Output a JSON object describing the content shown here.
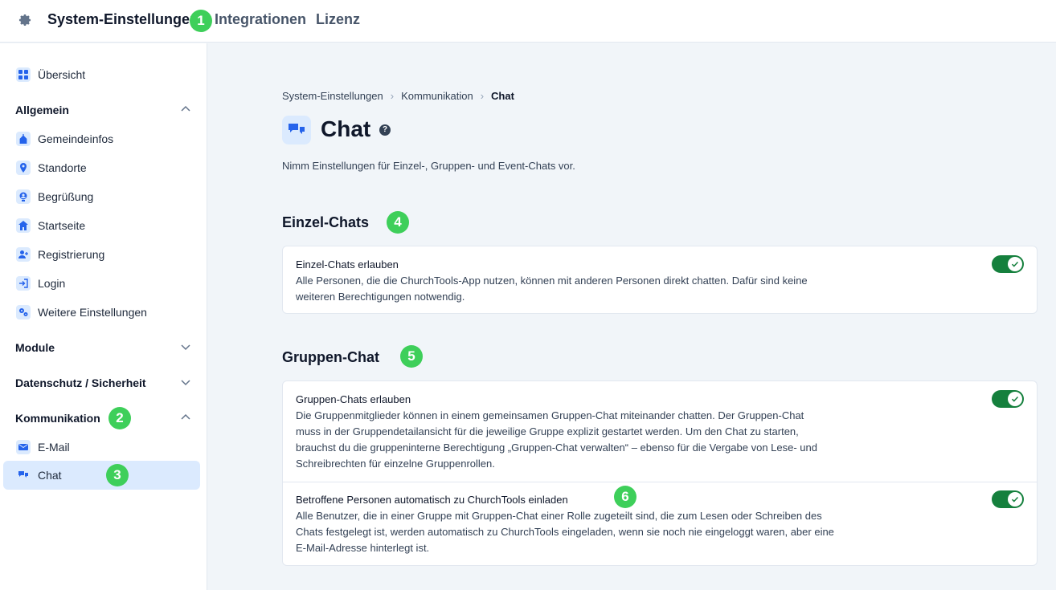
{
  "topbar": {
    "title": "System-Einstellungen",
    "tabs": [
      "Integrationen",
      "Lizenz"
    ]
  },
  "sidebar": {
    "overview": "Übersicht",
    "sections": {
      "allgemein": "Allgemein",
      "module": "Module",
      "datenschutz": "Datenschutz / Sicherheit",
      "kommunikation": "Kommunikation"
    },
    "allgemein_items": [
      "Gemeindeinfos",
      "Standorte",
      "Begrüßung",
      "Startseite",
      "Registrierung",
      "Login",
      "Weitere Einstellungen"
    ],
    "kommunikation_items": [
      "E-Mail",
      "Chat"
    ]
  },
  "breadcrumb": [
    "System-Einstellungen",
    "Kommunikation",
    "Chat"
  ],
  "page": {
    "title": "Chat",
    "help": "?",
    "description": "Nimm Einstellungen für Einzel-, Gruppen- und Event-Chats vor."
  },
  "sections": {
    "einzel": {
      "title": "Einzel-Chats",
      "rows": [
        {
          "title": "Einzel-Chats erlauben",
          "lines": [
            "Alle Personen, die die ChurchTools-App nutzen, können mit anderen Personen direkt chatten. Dafür sind keine",
            "weiteren Berechtigungen notwendig."
          ],
          "enabled": true
        }
      ]
    },
    "gruppen": {
      "title": "Gruppen-Chat",
      "rows": [
        {
          "title": "Gruppen-Chats erlauben",
          "lines": [
            "Die Gruppenmitglieder können in einem gemeinsamen Gruppen-Chat miteinander chatten. Der Gruppen-Chat",
            "muss in der Gruppendetailansicht für die jeweilige Gruppe explizit gestartet werden. Um den Chat zu starten,",
            "brauchst du die gruppeninterne Berechtigung „Gruppen-Chat verwalten“ – ebenso für die Vergabe von Lese- und",
            "Schreibrechten für einzelne Gruppenrollen."
          ],
          "enabled": true
        },
        {
          "title": "Betroffene Personen automatisch zu ChurchTools einladen",
          "lines": [
            "Alle Benutzer, die in einer Gruppe mit Gruppen-Chat einer Rolle zugeteilt sind, die zum Lesen oder Schreiben des",
            "Chats festgelegt ist, werden automatisch zu ChurchTools eingeladen, wenn sie noch nie eingeloggt waren, aber eine",
            "E-Mail-Adresse hinterlegt ist."
          ],
          "enabled": true
        }
      ]
    }
  },
  "markers": [
    "1",
    "2",
    "3",
    "4",
    "5",
    "6"
  ],
  "colors": {
    "accent": "#2563eb",
    "toggle_on": "#15803d",
    "marker": "#3ecf5a",
    "active_bg": "#dbeafe"
  }
}
